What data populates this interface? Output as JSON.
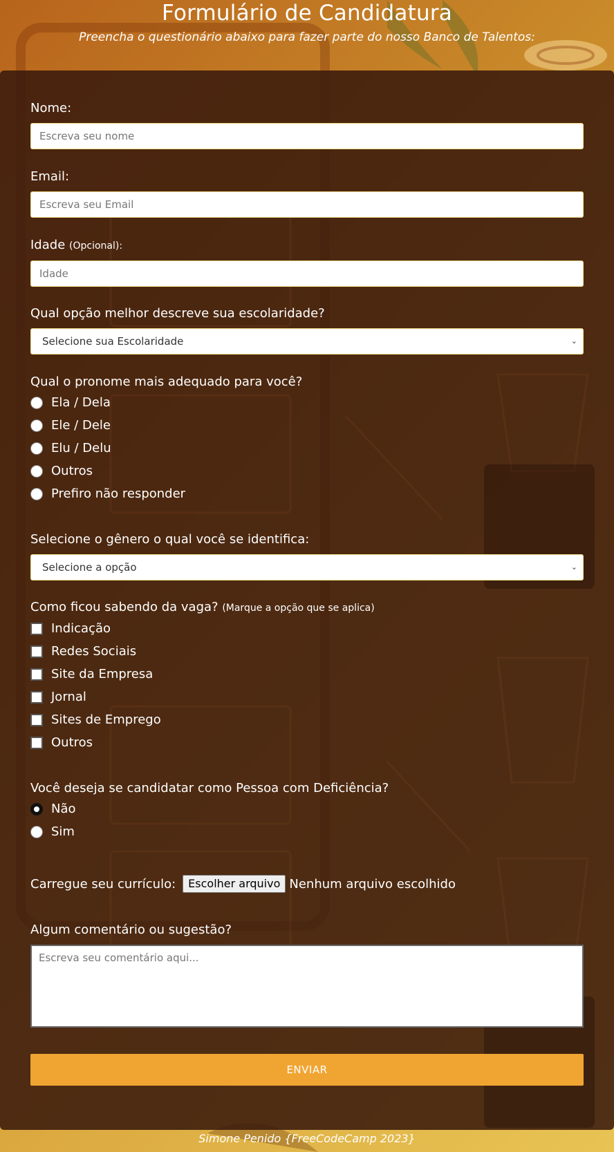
{
  "header": {
    "title": "Formulário de Candidatura",
    "subtitle": "Preencha o questionário abaixo para fazer parte do nosso Banco de Talentos:"
  },
  "form": {
    "name": {
      "label": "Nome:",
      "placeholder": "Escreva seu nome"
    },
    "email": {
      "label": "Email:",
      "placeholder": "Escreva seu Email"
    },
    "age": {
      "label": "Idade",
      "note": "(Opcional):",
      "placeholder": "Idade"
    },
    "education": {
      "label": "Qual opção melhor descreve sua escolaridade?",
      "selected": "Selecione sua Escolaridade"
    },
    "pronoun": {
      "label": "Qual o pronome mais adequado para você?",
      "options": [
        "Ela / Dela",
        "Ele / Dele",
        "Elu / Delu",
        "Outros",
        "Prefiro não responder"
      ]
    },
    "gender": {
      "label": "Selecione o gênero o qual você se identifica:",
      "selected": "Selecione a opção"
    },
    "source": {
      "label": "Como ficou sabendo da vaga?",
      "note": "(Marque a opção que se aplica)",
      "options": [
        "Indicação",
        "Redes Sociais",
        "Site da Empresa",
        "Jornal",
        "Sites de Emprego",
        "Outros"
      ]
    },
    "pcd": {
      "label": "Você deseja se candidatar como Pessoa com Deficiência?",
      "options": [
        "Não",
        "Sim"
      ],
      "selected": "Não"
    },
    "resume": {
      "label": "Carregue seu currículo:",
      "button": "Escolher arquivo",
      "status": "Nenhum arquivo escolhido"
    },
    "comment": {
      "label": "Algum comentário ou sugestão?",
      "placeholder": "Escreva seu comentário aqui..."
    },
    "submit": "ENVIAR"
  },
  "footer": "Simone Penido {FreeCodeCamp 2023}"
}
